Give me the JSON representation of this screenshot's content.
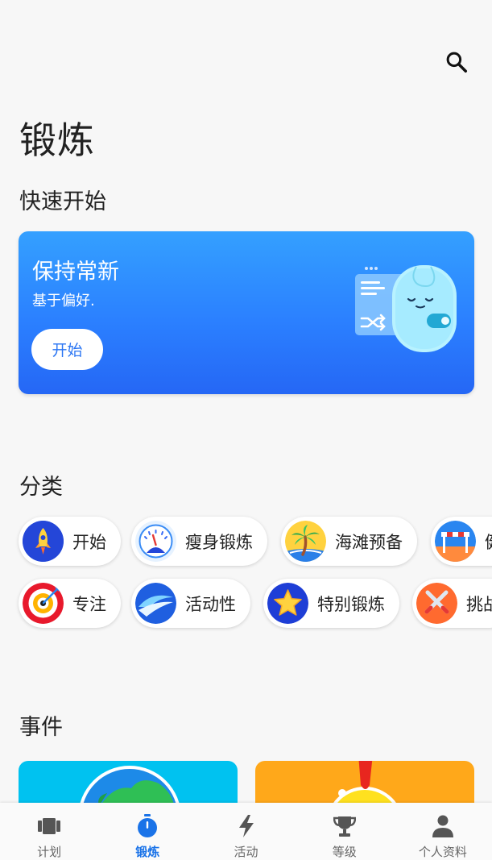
{
  "header": {
    "title": "锻炼",
    "search_icon": "search-icon"
  },
  "quick_start": {
    "section_title": "快速开始",
    "card": {
      "title": "保持常新",
      "subtitle": "基于偏好.",
      "button_label": "开始",
      "gradient_colors": [
        "#34a0ff",
        "#2567f5"
      ]
    }
  },
  "categories": {
    "section_title": "分类",
    "row1": [
      {
        "label": "开始",
        "icon": "rocket-icon"
      },
      {
        "label": "瘦身锻炼",
        "icon": "scale-icon"
      },
      {
        "label": "海滩预备",
        "icon": "palm-tree-icon"
      },
      {
        "label": "健",
        "icon": "hurdle-icon"
      }
    ],
    "row2": [
      {
        "label": "专注",
        "icon": "target-icon"
      },
      {
        "label": "活动性",
        "icon": "swirl-icon"
      },
      {
        "label": "特别锻炼",
        "icon": "star-icon"
      },
      {
        "label": "挑战",
        "icon": "swords-icon"
      }
    ]
  },
  "events": {
    "section_title": "事件"
  },
  "bottom_nav": {
    "active": "锻炼",
    "active_color": "#1a73e8",
    "items": [
      {
        "label": "计划",
        "icon": "calendar-plan-icon"
      },
      {
        "label": "锻炼",
        "icon": "stopwatch-icon"
      },
      {
        "label": "活动",
        "icon": "lightning-icon"
      },
      {
        "label": "等级",
        "icon": "trophy-icon"
      },
      {
        "label": "个人资料",
        "icon": "person-icon"
      }
    ]
  }
}
